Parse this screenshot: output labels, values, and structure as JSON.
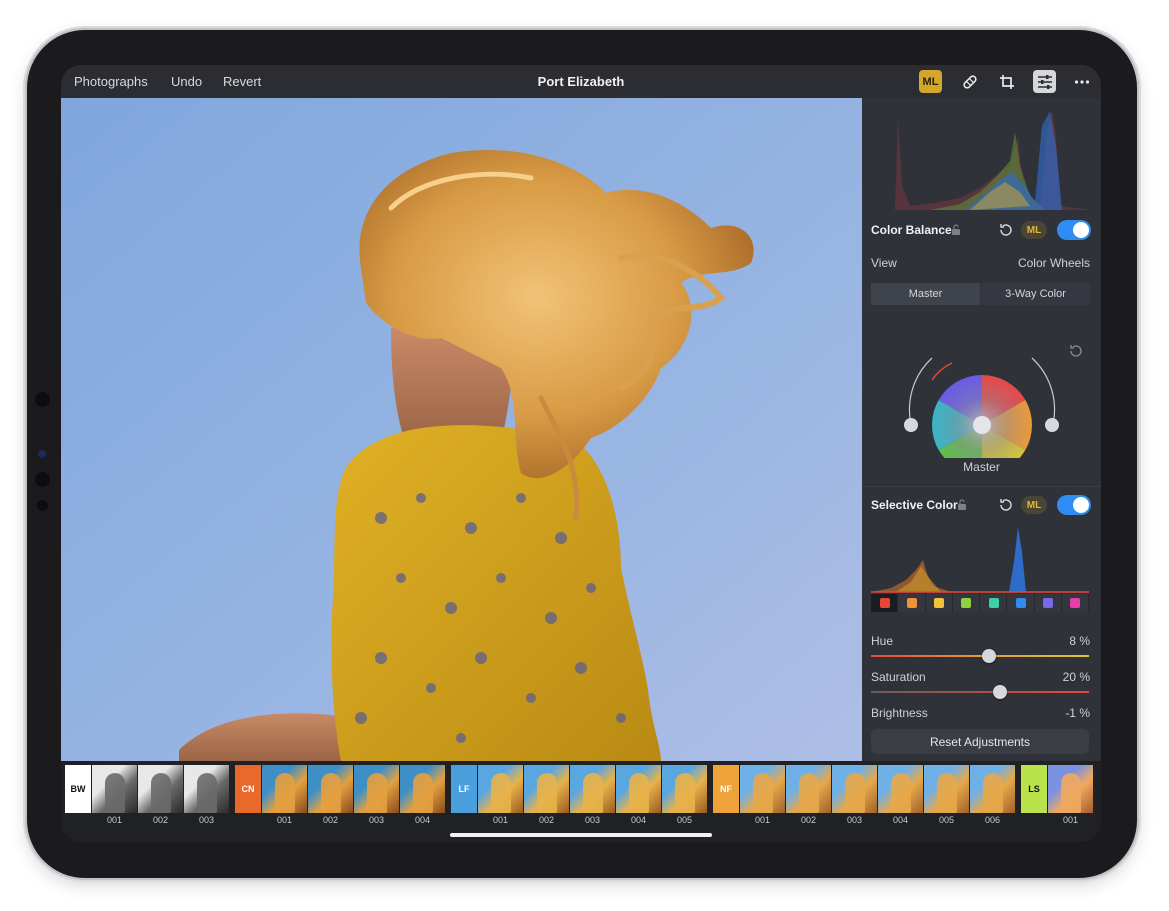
{
  "toolbar": {
    "photographs": "Photographs",
    "undo": "Undo",
    "revert": "Revert",
    "title": "Port Elizabeth",
    "ml_badge": "ML",
    "icons": [
      "ml-icon",
      "healing-brush-icon",
      "crop-icon",
      "adjustments-icon",
      "more-icon"
    ]
  },
  "color_balance": {
    "title": "Color Balance",
    "ml": "ML",
    "view_label": "View",
    "view_value": "Color Wheels",
    "segments": [
      "Master",
      "3-Way Color"
    ],
    "wheel_label": "Master",
    "enabled": true
  },
  "selective_color": {
    "title": "Selective Color",
    "ml": "ML",
    "enabled": true,
    "swatch_colors": [
      "#e8463a",
      "#f0913c",
      "#f2c23a",
      "#8fd040",
      "#3ccfa8",
      "#2f8cf2",
      "#7a68e8",
      "#e83ea8"
    ],
    "sliders": [
      {
        "label": "Hue",
        "value": "8 %",
        "level": 0.54
      },
      {
        "label": "Saturation",
        "value": "20 %",
        "level": 0.59
      },
      {
        "label": "Brightness",
        "value": "-1 %"
      }
    ],
    "reset_label": "Reset Adjustments"
  },
  "filmstrip": {
    "groups": [
      {
        "tag": "BW",
        "color": "#ffffff",
        "text_color": "#111111",
        "items": [
          "001",
          "002",
          "003"
        ]
      },
      {
        "tag": "CN",
        "color": "#e8692a",
        "text_color": "#ffffff",
        "items": [
          "001",
          "002",
          "003",
          "004"
        ]
      },
      {
        "tag": "LF",
        "color": "#4aa0dc",
        "text_color": "#ffffff",
        "items": [
          "001",
          "002",
          "003",
          "004",
          "005"
        ]
      },
      {
        "tag": "NF",
        "color": "#f0a23a",
        "text_color": "#ffffff",
        "items": [
          "001",
          "002",
          "003",
          "004",
          "005",
          "006"
        ]
      },
      {
        "tag": "LS",
        "color": "#b9e34a",
        "text_color": "#111111",
        "items": [
          "001"
        ]
      }
    ]
  },
  "colors": {
    "accent": "#2f8cf2",
    "ml_gold": "#d4a72c",
    "panel_bg": "#2f3238"
  }
}
